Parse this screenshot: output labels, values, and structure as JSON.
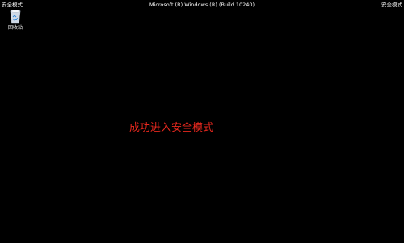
{
  "desktop": {
    "corner_left_label": "安全模式",
    "corner_right_label": "安全模式",
    "build_info": "Microsoft (R) Windows (R) (Build 10240)",
    "recycle_bin": {
      "icon": "recycle-bin-icon",
      "label": "回收站"
    },
    "center_message": "成功进入安全模式"
  },
  "colors": {
    "background": "#000000",
    "text": "#ffffff",
    "message": "#e8281e"
  }
}
